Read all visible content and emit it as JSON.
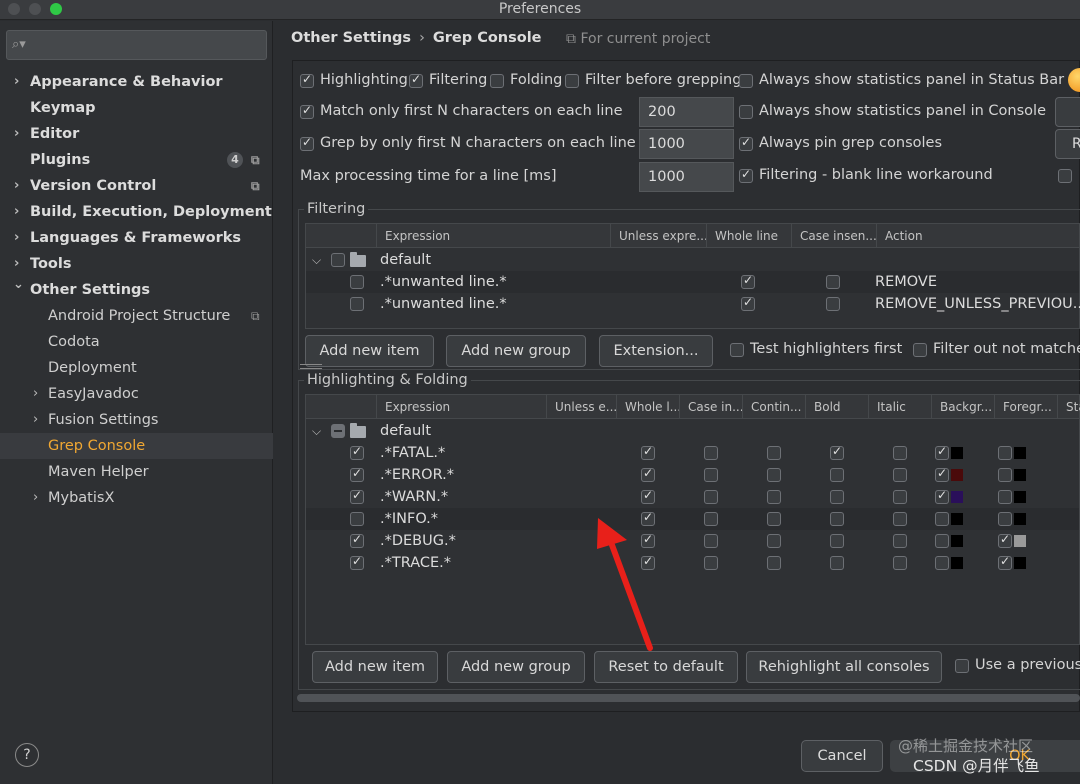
{
  "window": {
    "title": "Preferences"
  },
  "sidebar": {
    "search_placeholder": "",
    "items": [
      {
        "label": "Appearance & Behavior",
        "chevron": "›"
      },
      {
        "label": "Keymap"
      },
      {
        "label": "Editor",
        "chevron": "›"
      },
      {
        "label": "Plugins",
        "badge": "4"
      },
      {
        "label": "Version Control",
        "chevron": "›"
      },
      {
        "label": "Build, Execution, Deployment",
        "chevron": "›"
      },
      {
        "label": "Languages & Frameworks",
        "chevron": "›"
      },
      {
        "label": "Tools",
        "chevron": "›"
      },
      {
        "label": "Other Settings",
        "chevron": "⌄"
      },
      {
        "label": "Android Project Structure"
      },
      {
        "label": "Codota"
      },
      {
        "label": "Deployment"
      },
      {
        "label": "EasyJavadoc",
        "chevron": "›"
      },
      {
        "label": "Fusion Settings",
        "chevron": "›"
      },
      {
        "label": "Grep Console"
      },
      {
        "label": "Maven Helper"
      },
      {
        "label": "MybatisX",
        "chevron": "›"
      }
    ],
    "help": "?"
  },
  "header": {
    "crumb1": "Other Settings",
    "separator": "›",
    "crumb2": "Grep Console",
    "for_project": "⧉ For current project"
  },
  "options": {
    "highlighting": "Highlighting",
    "filtering": "Filtering",
    "folding": "Folding",
    "filter_before": "Filter before grepping",
    "stats_status_bar": "Always show statistics panel in Status Bar",
    "match_first_n": "Match only first N characters on each line",
    "match_first_n_value": "200",
    "stats_console": "Always show statistics panel in Console",
    "grep_first_n": "Grep by only first N characters on each line",
    "grep_first_n_value": "1000",
    "pin_consoles": "Always pin grep consoles",
    "max_time": "Max processing time for a line [ms]",
    "max_time_value": "1000",
    "blank_line": "Filtering - blank line workaround",
    "cut_r": "R"
  },
  "filtering": {
    "title": "Filtering",
    "columns": [
      "Expression",
      "Unless expre...",
      "Whole line",
      "Case insen...",
      "Action"
    ],
    "group": "default",
    "rows": [
      {
        "expr": ".*unwanted line.*",
        "action": "REMOVE"
      },
      {
        "expr": ".*unwanted line.*",
        "action": "REMOVE_UNLESS_PREVIOU..."
      }
    ],
    "buttons": {
      "add_item": "Add new item",
      "add_group": "Add new group",
      "extension": "Extension..."
    },
    "test_highlighters": "Test highlighters first",
    "filter_out": "Filter out not matched"
  },
  "highlighting": {
    "title": "Highlighting & Folding",
    "columns": [
      "Expression",
      "Unless e...",
      "Whole l...",
      "Case in...",
      "Contin...",
      "Bold",
      "Italic",
      "Backgr...",
      "Foregr...",
      "Sta"
    ],
    "group": "default",
    "rows": [
      {
        "expr": ".*FATAL.*",
        "enabled": true,
        "bold": true,
        "bg_on": true,
        "bg": "#000000",
        "fg_on": false,
        "fg": "#000000"
      },
      {
        "expr": ".*ERROR.*",
        "enabled": true,
        "bold": false,
        "bg_on": true,
        "bg": "#4a0a0a",
        "fg_on": false,
        "fg": "#000000"
      },
      {
        "expr": ".*WARN.*",
        "enabled": true,
        "bold": false,
        "bg_on": true,
        "bg": "#2a0f5a",
        "fg_on": false,
        "fg": "#000000"
      },
      {
        "expr": ".*INFO.*",
        "enabled": false,
        "bold": false,
        "bg_on": false,
        "bg": "#000000",
        "fg_on": false,
        "fg": "#000000"
      },
      {
        "expr": ".*DEBUG.*",
        "enabled": true,
        "bold": false,
        "bg_on": false,
        "bg": "#000000",
        "fg_on": true,
        "fg": "#9a9a9a"
      },
      {
        "expr": ".*TRACE.*",
        "enabled": true,
        "bold": false,
        "bg_on": false,
        "bg": "#000000",
        "fg_on": true,
        "fg": "#000000"
      }
    ],
    "buttons": {
      "add_item": "Add new item",
      "add_group": "Add new group",
      "reset": "Reset to default",
      "rehighlight": "Rehighlight all consoles"
    },
    "use_previous": "Use a previous"
  },
  "footer": {
    "cancel": "Cancel",
    "ok": "OK"
  },
  "watermark": {
    "line1": "@稀土掘金技术社区",
    "line2": "CSDN @月伴飞鱼"
  },
  "colors": {
    "accent": "#f0a732",
    "arrow": "#e8201a"
  }
}
